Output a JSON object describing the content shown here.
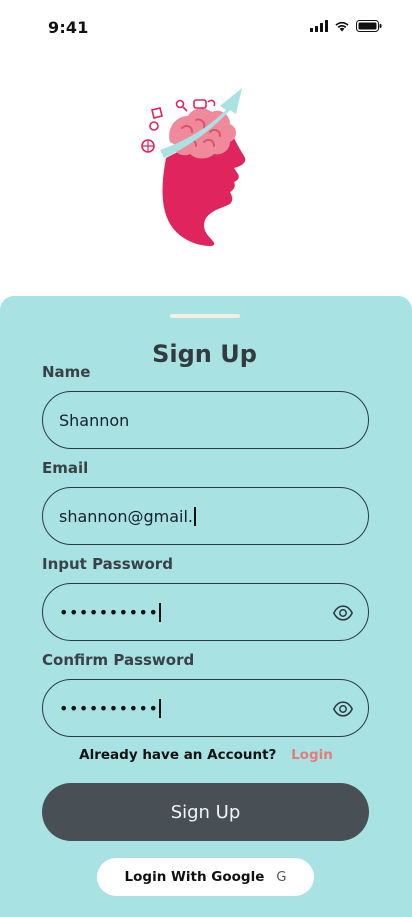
{
  "status_bar": {
    "time": "9:41"
  },
  "signup": {
    "title": "Sign Up",
    "fields": [
      {
        "label": "Name",
        "value": "Shannon"
      },
      {
        "label": "Email",
        "value": "shannon@gmail."
      },
      {
        "label": "Input Password",
        "value": "••••••••••"
      },
      {
        "label": "Confirm Password",
        "value": "••••••••••"
      }
    ],
    "account_prompt": "Already have an Account?",
    "login_link": "Login",
    "signup_button": "Sign Up",
    "google_button": "Login With Google",
    "google_icon_glyph": "G"
  },
  "colors": {
    "sheet_background": "#a8e2e3",
    "primary_button": "#485055",
    "link": "#e47c7a",
    "logo_head": "#e0245e",
    "logo_brain": "#f08a9a",
    "logo_arrow": "#a8e2e3"
  },
  "icons": [
    "signal-icon",
    "wifi-icon",
    "battery-icon",
    "brain-head-logo-icon",
    "eye-icon",
    "google-icon"
  ]
}
